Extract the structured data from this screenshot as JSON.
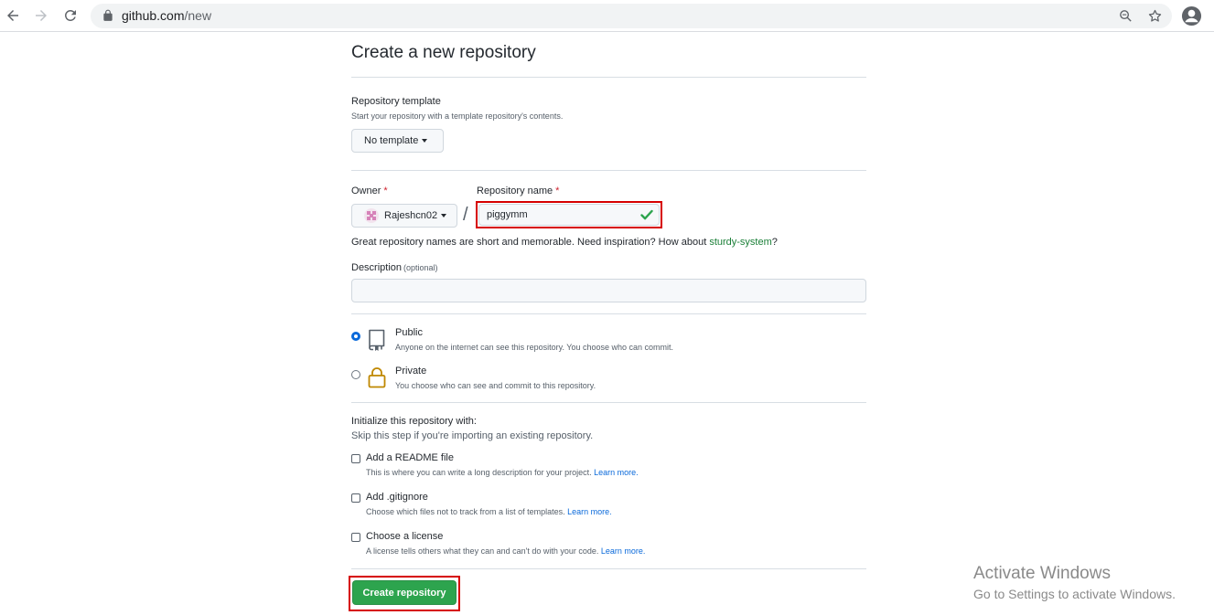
{
  "browser": {
    "url_host": "github.com",
    "url_path": "/new"
  },
  "page": {
    "title": "Create a new repository"
  },
  "template": {
    "label": "Repository template",
    "note": "Start your repository with a template repository's contents.",
    "button_label": "No template"
  },
  "owner": {
    "label": "Owner",
    "required_mark": "*",
    "value": "Rajeshcn02"
  },
  "separator": "/",
  "repo_name": {
    "label": "Repository name",
    "required_mark": "*",
    "value": "piggymm"
  },
  "hint": {
    "prefix": "Great repository names are short and memorable. Need inspiration? How about ",
    "suggestion": "sturdy-system",
    "suffix": "?"
  },
  "description": {
    "label": "Description",
    "optional": "(optional)",
    "value": ""
  },
  "visibility": {
    "public": {
      "label": "Public",
      "note": "Anyone on the internet can see this repository. You choose who can commit.",
      "selected": true
    },
    "private": {
      "label": "Private",
      "note": "You choose who can see and commit to this repository.",
      "selected": false
    }
  },
  "init": {
    "heading": "Initialize this repository with:",
    "subheading": "Skip this step if you're importing an existing repository.",
    "options": [
      {
        "label": "Add a README file",
        "note": "This is where you can write a long description for your project.",
        "link": "Learn more."
      },
      {
        "label": "Add .gitignore",
        "note": "Choose which files not to track from a list of templates.",
        "link": "Learn more."
      },
      {
        "label": "Choose a license",
        "note": "A license tells others what they can and can't do with your code.",
        "link": "Learn more."
      }
    ]
  },
  "submit": {
    "label": "Create repository"
  },
  "watermark": {
    "title": "Activate Windows",
    "subtitle": "Go to Settings to activate Windows."
  },
  "colors": {
    "accent_green": "#2da44e",
    "highlight_red": "#d60000",
    "link_blue": "#0969da",
    "link_green": "#1a7f37"
  }
}
